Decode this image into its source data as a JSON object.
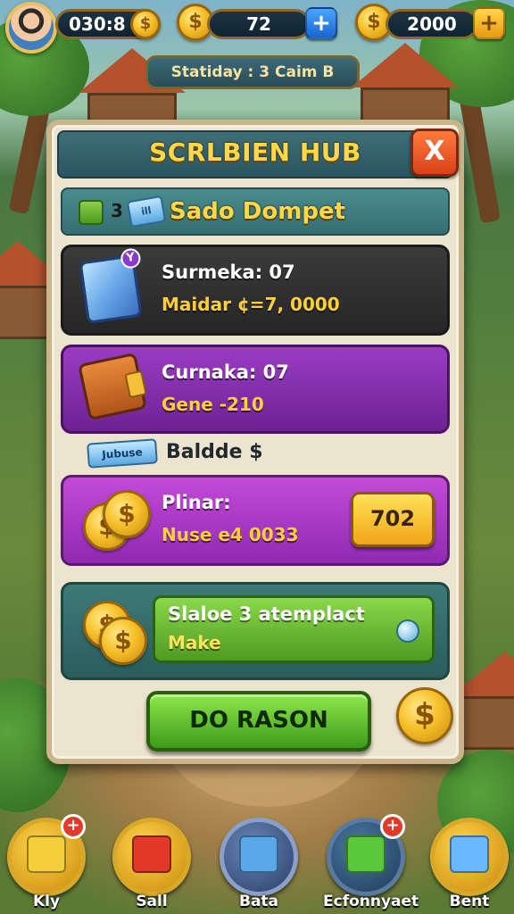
{
  "hud": {
    "player_code": "030:8",
    "coins": "72",
    "gold": "2000",
    "currency_icon": "$"
  },
  "subbanner": "Statiday : 3 Caim B",
  "panel": {
    "title": "SCRLBIEN HUB",
    "close_label": "X",
    "wallet": {
      "count": "3",
      "ticket": "ill",
      "label": "Sado Dompet"
    },
    "items": [
      {
        "line1": "Surmeka: 07",
        "line2": "Maidar ¢=7, 0000",
        "badge": "Y"
      },
      {
        "line1": "Curnaka: 07",
        "line2": "Gene -210"
      }
    ],
    "tag": {
      "ticket": "Jubuse",
      "text": "Baldde $"
    },
    "offer": {
      "line1": "Plinar:",
      "line2": "Nuse e4 0033",
      "value": "702"
    },
    "exchange": {
      "line1": "Slaloe 3 atemplact",
      "line2": "Make"
    },
    "primary_button": "DO RASON"
  },
  "nav": [
    {
      "label": "Kly",
      "badge": "+",
      "color": "#f4cf3a"
    },
    {
      "label": "Sall",
      "badge": "",
      "color": "#e23a2a"
    },
    {
      "label": "Bata",
      "badge": "",
      "color": "#5aa8e8"
    },
    {
      "label": "Ecfonnyaet",
      "badge": "+",
      "color": "#5ac83a"
    },
    {
      "label": "Bent",
      "badge": "",
      "color": "#6ab8ff"
    }
  ]
}
